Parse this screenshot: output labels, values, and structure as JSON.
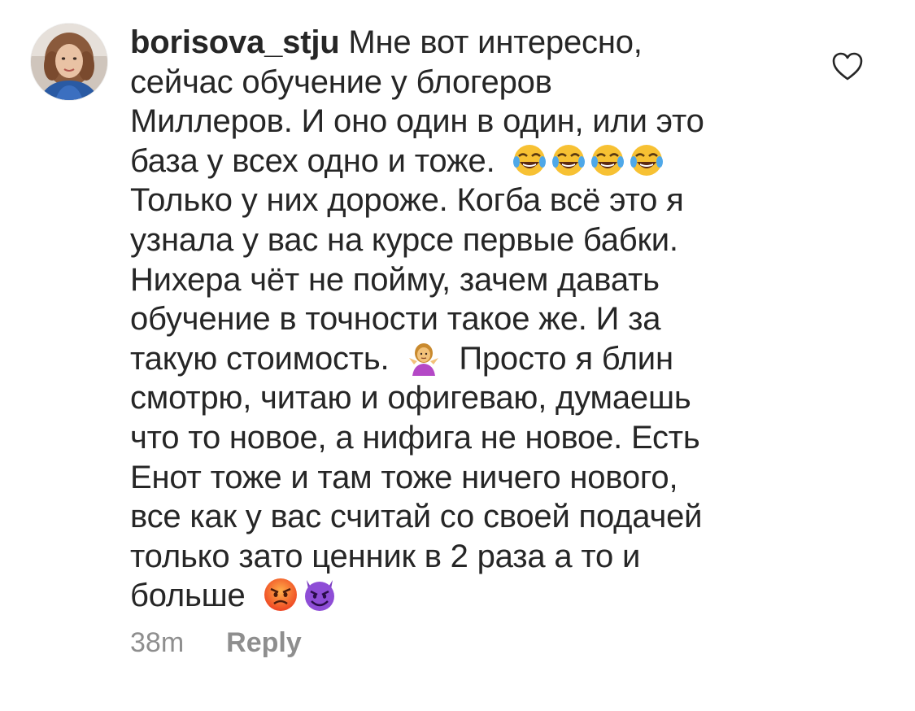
{
  "comment": {
    "username": "borisova_stju",
    "lines": [
      "Мне вот интересно,",
      "сейчас обучение у блогеров",
      "Миллеров. И оно один в один, или это",
      "база у всех одно и тоже.",
      "Только у них дороже. Когба всё это я",
      "узнала у вас на курсе первые бабки.",
      "Нихера чёт не пойму, зачем давать",
      "обучение в точности такое же. И за",
      "такую стоимость.",
      "Просто я блин",
      "смотрю, читаю и офигеваю, думаешь",
      "что то новое, а нифига не новое. Есть",
      "Енот тоже и там тоже ничего нового,",
      "все как у вас считай со своей подачей",
      "только зато ценник в 2 раза а то и",
      "больше"
    ],
    "emojis": {
      "laugh": "face-with-tears-of-joy",
      "shrug": "person-shrugging",
      "angry": "pouting-face",
      "devil": "smiling-face-with-horns"
    },
    "timestamp": "38m",
    "reply_label": "Reply"
  },
  "colors": {
    "text": "#262626",
    "muted": "#8e8e8e",
    "background": "#ffffff"
  },
  "icons": {
    "like": "heart-outline-icon",
    "avatar": "user-avatar"
  }
}
